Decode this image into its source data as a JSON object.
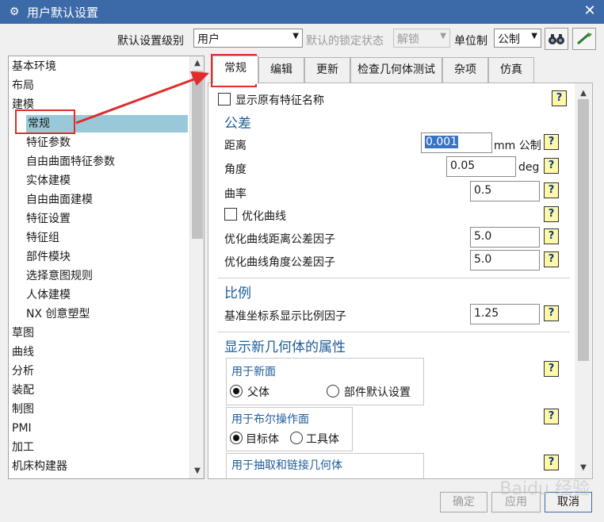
{
  "window": {
    "title": "用户默认设置",
    "close_glyph": "✕",
    "icon": "gear-icon"
  },
  "toolbar": {
    "level_label": "默认设置级别",
    "level_value": "用户",
    "lock_label": "默认的锁定状态",
    "lock_value": "解锁",
    "unit_label": "单位制",
    "unit_value": "公制"
  },
  "tree": {
    "items": [
      {
        "label": "基本环境",
        "level": 0
      },
      {
        "label": "布局",
        "level": 0
      },
      {
        "label": "建模",
        "level": 0
      },
      {
        "label": "常规",
        "level": 1,
        "selected": true
      },
      {
        "label": "特征参数",
        "level": 1
      },
      {
        "label": "自由曲面特征参数",
        "level": 1
      },
      {
        "label": "实体建模",
        "level": 1
      },
      {
        "label": "自由曲面建模",
        "level": 1
      },
      {
        "label": "特征设置",
        "level": 1
      },
      {
        "label": "特征组",
        "level": 1
      },
      {
        "label": "部件模块",
        "level": 1
      },
      {
        "label": "选择意图规则",
        "level": 1
      },
      {
        "label": "人体建模",
        "level": 1
      },
      {
        "label": "NX 创意塑型",
        "level": 1
      },
      {
        "label": "草图",
        "level": 0
      },
      {
        "label": "曲线",
        "level": 0
      },
      {
        "label": "分析",
        "level": 0
      },
      {
        "label": "装配",
        "level": 0
      },
      {
        "label": "制图",
        "level": 0
      },
      {
        "label": "PMI",
        "level": 0
      },
      {
        "label": "加工",
        "level": 0
      },
      {
        "label": "机床构建器",
        "level": 0
      }
    ]
  },
  "tabs": [
    {
      "label": "常规",
      "active": true
    },
    {
      "label": "编辑"
    },
    {
      "label": "更新"
    },
    {
      "label": "检查几何体测试"
    },
    {
      "label": "杂项"
    },
    {
      "label": "仿真"
    }
  ],
  "panel": {
    "show_feature_names": "显示原有特征名称",
    "tolerance": {
      "title": "公差",
      "distance_label": "距离",
      "distance_value": "0.001",
      "distance_unit": "mm 公制",
      "angle_label": "角度",
      "angle_value": "0.05",
      "angle_unit": "deg",
      "curvature_label": "曲率",
      "curvature_value": "0.5",
      "optimize_curve_label": "优化曲线",
      "opt_dist_label": "优化曲线距离公差因子",
      "opt_dist_value": "5.0",
      "opt_angle_label": "优化曲线角度公差因子",
      "opt_angle_value": "5.0"
    },
    "scale": {
      "title": "比例",
      "datum_label": "基准坐标系显示比例因子",
      "datum_value": "1.25"
    },
    "new_geom": {
      "title": "显示新几何体的属性",
      "new_face_title": "用于新面",
      "new_face_opt1": "父体",
      "new_face_opt2": "部件默认设置",
      "boolean_title": "用于布尔操作面",
      "boolean_opt1": "目标体",
      "boolean_opt2": "工具体",
      "extract_title": "用于抽取和链接几何体"
    },
    "help_glyph": "?"
  },
  "buttons": {
    "ok": "确定",
    "apply": "应用",
    "cancel": "取消"
  },
  "watermark": "Baidu 经验",
  "colors": {
    "titlebar": "#3c6aa8",
    "selection": "#99c9d9",
    "callout": "#e02c2c",
    "section": "#1c5c9a"
  }
}
